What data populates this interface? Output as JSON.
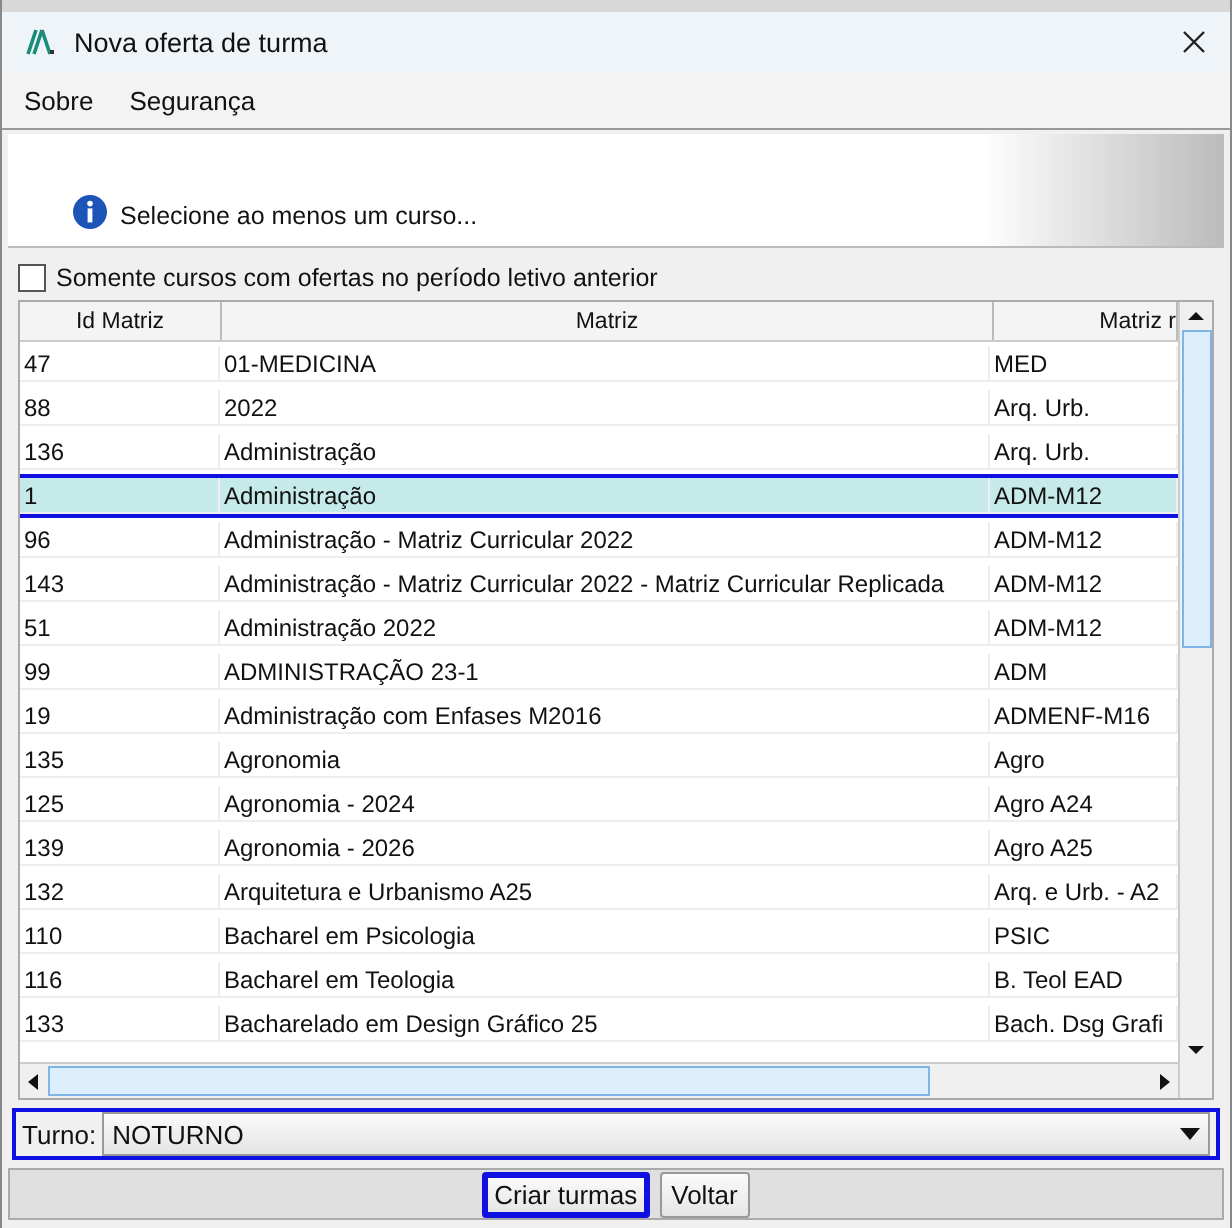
{
  "window": {
    "title": "Nova oferta de turma"
  },
  "menu": [
    {
      "label": "Sobre"
    },
    {
      "label": "Segurança"
    }
  ],
  "info": {
    "message": "Selecione ao menos um curso..."
  },
  "filter": {
    "label": "Somente cursos com ofertas no período letivo anterior",
    "checked": false
  },
  "table": {
    "columns": [
      "Id Matriz",
      "Matriz",
      "Matriz r"
    ],
    "rows": [
      {
        "cells": [
          "47",
          "01-MEDICINA",
          "MED"
        ],
        "selected": false
      },
      {
        "cells": [
          "88",
          "2022",
          "Arq. Urb."
        ],
        "selected": false
      },
      {
        "cells": [
          "136",
          "Administração",
          "Arq. Urb."
        ],
        "selected": false
      },
      {
        "cells": [
          "1",
          "Administração",
          "ADM-M12"
        ],
        "selected": true
      },
      {
        "cells": [
          "96",
          "Administração - Matriz Curricular 2022",
          "ADM-M12"
        ],
        "selected": false
      },
      {
        "cells": [
          "143",
          "Administração - Matriz Curricular 2022 - Matriz Curricular Replicada",
          "ADM-M12"
        ],
        "selected": false
      },
      {
        "cells": [
          "51",
          "Administração 2022",
          "ADM-M12"
        ],
        "selected": false
      },
      {
        "cells": [
          "99",
          "ADMINISTRAÇÃO 23-1",
          "ADM"
        ],
        "selected": false
      },
      {
        "cells": [
          "19",
          "Administração com Enfases M2016",
          "ADMENF-M16"
        ],
        "selected": false
      },
      {
        "cells": [
          "135",
          "Agronomia",
          "Agro"
        ],
        "selected": false
      },
      {
        "cells": [
          "125",
          "Agronomia - 2024",
          "Agro A24"
        ],
        "selected": false
      },
      {
        "cells": [
          "139",
          "Agronomia - 2026",
          "Agro A25"
        ],
        "selected": false
      },
      {
        "cells": [
          "132",
          "Arquitetura e Urbanismo A25",
          "Arq. e Urb. - A2"
        ],
        "selected": false
      },
      {
        "cells": [
          "110",
          "Bacharel em Psicologia",
          "PSIC"
        ],
        "selected": false
      },
      {
        "cells": [
          "116",
          "Bacharel em Teologia",
          "B. Teol EAD"
        ],
        "selected": false
      },
      {
        "cells": [
          "133",
          "Bacharelado em Design Gráfico 25",
          "Bach. Dsg Grafi"
        ],
        "selected": false
      }
    ]
  },
  "turno": {
    "label": "Turno:",
    "value": "NOTURNO",
    "focused": true
  },
  "buttons": [
    {
      "label": "Criar turmas",
      "focused": true
    },
    {
      "label": "Voltar",
      "focused": false
    }
  ]
}
